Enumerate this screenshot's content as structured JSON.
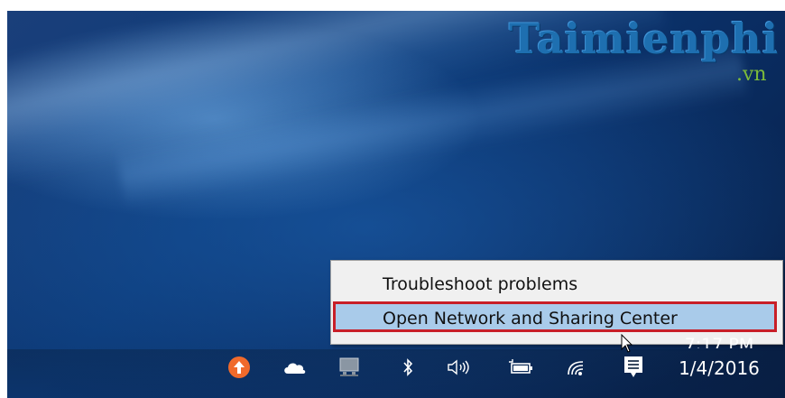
{
  "watermark": {
    "brand": "Taimienphi",
    "suffix": ".vn"
  },
  "context_menu": {
    "items": [
      {
        "label": "Troubleshoot problems",
        "highlighted": false
      },
      {
        "label": "Open Network and Sharing Center",
        "highlighted": true
      }
    ]
  },
  "tray": {
    "icons": [
      {
        "name": "update-arrow-icon",
        "color": "#f06a2b"
      },
      {
        "name": "onedrive-cloud-icon",
        "color": "#ffffff"
      },
      {
        "name": "network-computer-icon",
        "color": "#9aa4b0"
      },
      {
        "name": "bluetooth-icon",
        "color": "#ffffff"
      },
      {
        "name": "volume-icon",
        "color": "#ffffff"
      },
      {
        "name": "battery-icon",
        "color": "#ffffff"
      },
      {
        "name": "wifi-icon",
        "color": "#ffffff"
      },
      {
        "name": "action-center-icon",
        "color": "#ffffff"
      }
    ]
  },
  "clock": {
    "time": "7:17 PM",
    "date": "1/4/2016"
  },
  "colors": {
    "menu_background": "#f0f0f0",
    "highlight": "#a9cbea",
    "highlight_border": "#c81f28",
    "accent_orange": "#f06a2b",
    "desktop_blue": "#0c3a78"
  }
}
